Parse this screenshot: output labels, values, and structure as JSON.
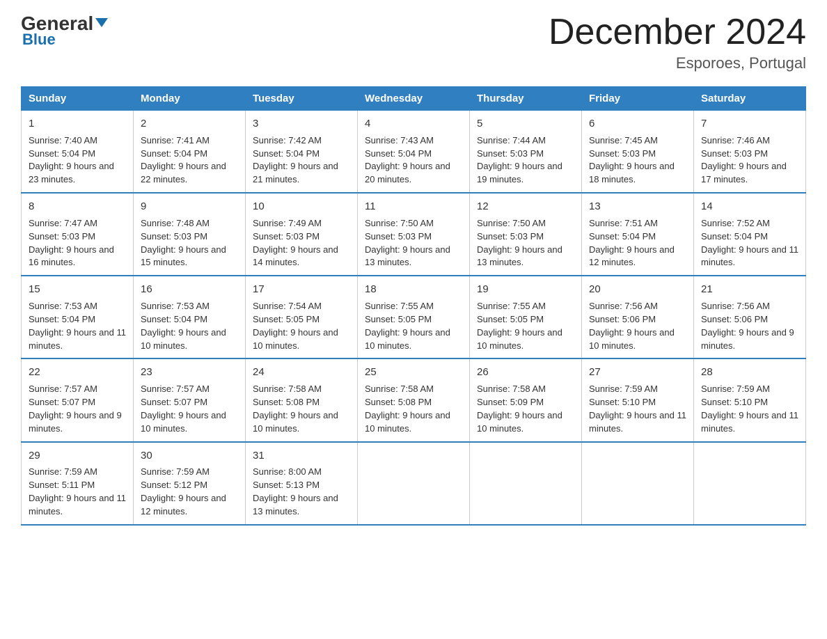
{
  "header": {
    "logo_general": "General",
    "logo_blue": "Blue",
    "title": "December 2024",
    "location": "Esporoes, Portugal"
  },
  "days_of_week": [
    "Sunday",
    "Monday",
    "Tuesday",
    "Wednesday",
    "Thursday",
    "Friday",
    "Saturday"
  ],
  "weeks": [
    [
      {
        "day": "1",
        "sunrise": "Sunrise: 7:40 AM",
        "sunset": "Sunset: 5:04 PM",
        "daylight": "Daylight: 9 hours and 23 minutes."
      },
      {
        "day": "2",
        "sunrise": "Sunrise: 7:41 AM",
        "sunset": "Sunset: 5:04 PM",
        "daylight": "Daylight: 9 hours and 22 minutes."
      },
      {
        "day": "3",
        "sunrise": "Sunrise: 7:42 AM",
        "sunset": "Sunset: 5:04 PM",
        "daylight": "Daylight: 9 hours and 21 minutes."
      },
      {
        "day": "4",
        "sunrise": "Sunrise: 7:43 AM",
        "sunset": "Sunset: 5:04 PM",
        "daylight": "Daylight: 9 hours and 20 minutes."
      },
      {
        "day": "5",
        "sunrise": "Sunrise: 7:44 AM",
        "sunset": "Sunset: 5:03 PM",
        "daylight": "Daylight: 9 hours and 19 minutes."
      },
      {
        "day": "6",
        "sunrise": "Sunrise: 7:45 AM",
        "sunset": "Sunset: 5:03 PM",
        "daylight": "Daylight: 9 hours and 18 minutes."
      },
      {
        "day": "7",
        "sunrise": "Sunrise: 7:46 AM",
        "sunset": "Sunset: 5:03 PM",
        "daylight": "Daylight: 9 hours and 17 minutes."
      }
    ],
    [
      {
        "day": "8",
        "sunrise": "Sunrise: 7:47 AM",
        "sunset": "Sunset: 5:03 PM",
        "daylight": "Daylight: 9 hours and 16 minutes."
      },
      {
        "day": "9",
        "sunrise": "Sunrise: 7:48 AM",
        "sunset": "Sunset: 5:03 PM",
        "daylight": "Daylight: 9 hours and 15 minutes."
      },
      {
        "day": "10",
        "sunrise": "Sunrise: 7:49 AM",
        "sunset": "Sunset: 5:03 PM",
        "daylight": "Daylight: 9 hours and 14 minutes."
      },
      {
        "day": "11",
        "sunrise": "Sunrise: 7:50 AM",
        "sunset": "Sunset: 5:03 PM",
        "daylight": "Daylight: 9 hours and 13 minutes."
      },
      {
        "day": "12",
        "sunrise": "Sunrise: 7:50 AM",
        "sunset": "Sunset: 5:03 PM",
        "daylight": "Daylight: 9 hours and 13 minutes."
      },
      {
        "day": "13",
        "sunrise": "Sunrise: 7:51 AM",
        "sunset": "Sunset: 5:04 PM",
        "daylight": "Daylight: 9 hours and 12 minutes."
      },
      {
        "day": "14",
        "sunrise": "Sunrise: 7:52 AM",
        "sunset": "Sunset: 5:04 PM",
        "daylight": "Daylight: 9 hours and 11 minutes."
      }
    ],
    [
      {
        "day": "15",
        "sunrise": "Sunrise: 7:53 AM",
        "sunset": "Sunset: 5:04 PM",
        "daylight": "Daylight: 9 hours and 11 minutes."
      },
      {
        "day": "16",
        "sunrise": "Sunrise: 7:53 AM",
        "sunset": "Sunset: 5:04 PM",
        "daylight": "Daylight: 9 hours and 10 minutes."
      },
      {
        "day": "17",
        "sunrise": "Sunrise: 7:54 AM",
        "sunset": "Sunset: 5:05 PM",
        "daylight": "Daylight: 9 hours and 10 minutes."
      },
      {
        "day": "18",
        "sunrise": "Sunrise: 7:55 AM",
        "sunset": "Sunset: 5:05 PM",
        "daylight": "Daylight: 9 hours and 10 minutes."
      },
      {
        "day": "19",
        "sunrise": "Sunrise: 7:55 AM",
        "sunset": "Sunset: 5:05 PM",
        "daylight": "Daylight: 9 hours and 10 minutes."
      },
      {
        "day": "20",
        "sunrise": "Sunrise: 7:56 AM",
        "sunset": "Sunset: 5:06 PM",
        "daylight": "Daylight: 9 hours and 10 minutes."
      },
      {
        "day": "21",
        "sunrise": "Sunrise: 7:56 AM",
        "sunset": "Sunset: 5:06 PM",
        "daylight": "Daylight: 9 hours and 9 minutes."
      }
    ],
    [
      {
        "day": "22",
        "sunrise": "Sunrise: 7:57 AM",
        "sunset": "Sunset: 5:07 PM",
        "daylight": "Daylight: 9 hours and 9 minutes."
      },
      {
        "day": "23",
        "sunrise": "Sunrise: 7:57 AM",
        "sunset": "Sunset: 5:07 PM",
        "daylight": "Daylight: 9 hours and 10 minutes."
      },
      {
        "day": "24",
        "sunrise": "Sunrise: 7:58 AM",
        "sunset": "Sunset: 5:08 PM",
        "daylight": "Daylight: 9 hours and 10 minutes."
      },
      {
        "day": "25",
        "sunrise": "Sunrise: 7:58 AM",
        "sunset": "Sunset: 5:08 PM",
        "daylight": "Daylight: 9 hours and 10 minutes."
      },
      {
        "day": "26",
        "sunrise": "Sunrise: 7:58 AM",
        "sunset": "Sunset: 5:09 PM",
        "daylight": "Daylight: 9 hours and 10 minutes."
      },
      {
        "day": "27",
        "sunrise": "Sunrise: 7:59 AM",
        "sunset": "Sunset: 5:10 PM",
        "daylight": "Daylight: 9 hours and 11 minutes."
      },
      {
        "day": "28",
        "sunrise": "Sunrise: 7:59 AM",
        "sunset": "Sunset: 5:10 PM",
        "daylight": "Daylight: 9 hours and 11 minutes."
      }
    ],
    [
      {
        "day": "29",
        "sunrise": "Sunrise: 7:59 AM",
        "sunset": "Sunset: 5:11 PM",
        "daylight": "Daylight: 9 hours and 11 minutes."
      },
      {
        "day": "30",
        "sunrise": "Sunrise: 7:59 AM",
        "sunset": "Sunset: 5:12 PM",
        "daylight": "Daylight: 9 hours and 12 minutes."
      },
      {
        "day": "31",
        "sunrise": "Sunrise: 8:00 AM",
        "sunset": "Sunset: 5:13 PM",
        "daylight": "Daylight: 9 hours and 13 minutes."
      },
      null,
      null,
      null,
      null
    ]
  ]
}
